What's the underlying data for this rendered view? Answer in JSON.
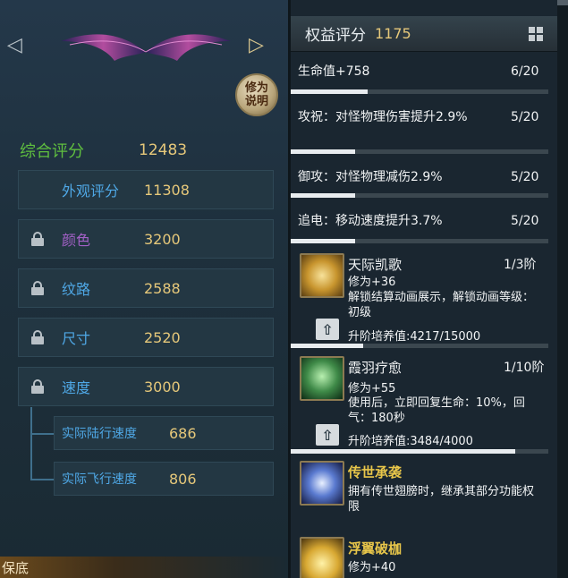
{
  "left_panel": {
    "modify_button_label": "修为说明",
    "total": {
      "label": "综合评分",
      "value": "12483"
    },
    "stats": [
      {
        "label": "外观评分",
        "value": "11308",
        "locked": false,
        "color": "#4fa8e6"
      },
      {
        "label": "颜色",
        "value": "3200",
        "locked": true,
        "color": "#a461c8"
      },
      {
        "label": "纹路",
        "value": "2588",
        "locked": true,
        "color": "#4fa8e6"
      },
      {
        "label": "尺寸",
        "value": "2520",
        "locked": true,
        "color": "#4fa8e6"
      },
      {
        "label": "速度",
        "value": "3000",
        "locked": true,
        "color": "#4fa8e6"
      }
    ],
    "sub_stats": [
      {
        "label": "实际陆行速度",
        "value": "686"
      },
      {
        "label": "实际飞行速度",
        "value": "806"
      }
    ],
    "bottom_tab_label": "保底"
  },
  "right_panel": {
    "header": {
      "title": "权益评分",
      "score": "1175"
    },
    "attributes": [
      {
        "text": "生命值+758",
        "count": "6/20",
        "progress": 0.3
      },
      {
        "text": "攻祝：对怪物理伤害提升2.9%",
        "count": "5/20",
        "progress": 0.25
      },
      {
        "text": "御攻：对怪物理减伤2.9%",
        "count": "5/20",
        "progress": 0.25
      },
      {
        "text": "追电：移动速度提升3.7%",
        "count": "5/20",
        "progress": 0.25
      }
    ],
    "skills": [
      {
        "name": "天际凯歌",
        "level": "1/3阶",
        "line1": "修为+36",
        "line2": "解锁结算动画展示，解锁动画等级：初级",
        "train": "升阶培养值:4217/15000",
        "progress": 0.281,
        "icon": "gold-wing-burst-icon"
      },
      {
        "name": "霞羽疗愈",
        "level": "1/10阶",
        "line1": "修为+55",
        "line2": "使用后，立即回复生命：10%，回气：180秒",
        "train": "升阶培养值:3484/4000",
        "progress": 0.871,
        "icon": "healing-figure-icon"
      },
      {
        "name": "传世承袭",
        "line1": "拥有传世翅膀时，继承其部分功能权限",
        "icon": "blue-wing-crest-icon"
      },
      {
        "name": "浮翼破枷",
        "line1": "修为+40",
        "icon": "golden-wing-icon"
      }
    ]
  }
}
